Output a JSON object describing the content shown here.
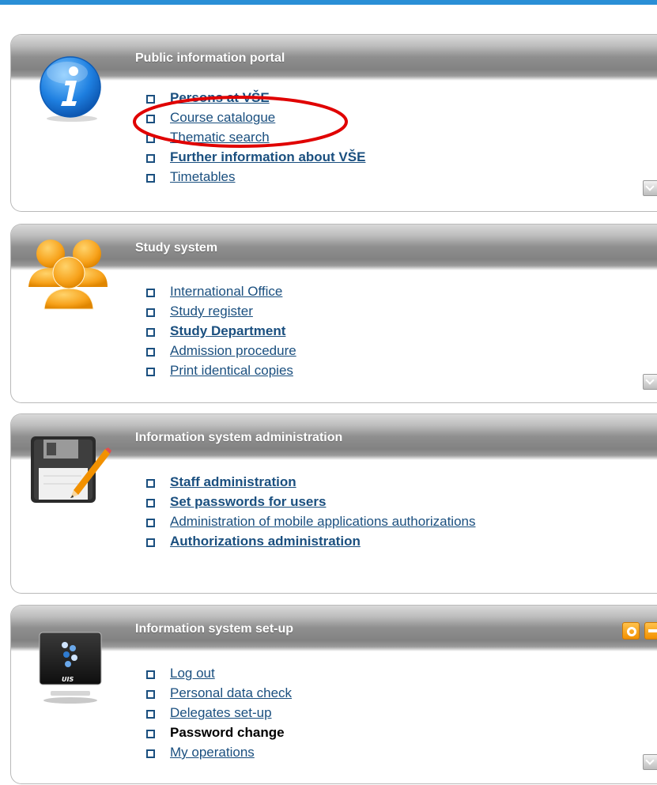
{
  "colors": {
    "top_bar": "#2a8fd6",
    "link": "#1a4f7f",
    "button_orange": "#f29100",
    "annotation_red": "#e00000"
  },
  "panels": [
    {
      "title": "Public information portal",
      "icon": "info-icon",
      "items": [
        {
          "label": "Persons at VŠE",
          "bold": true
        },
        {
          "label": "Course catalogue",
          "bold": false
        },
        {
          "label": "Thematic search",
          "bold": false
        },
        {
          "label": "Further information about VŠE",
          "bold": true
        },
        {
          "label": "Timetables",
          "bold": false
        }
      ]
    },
    {
      "title": "Study system",
      "icon": "people-icon",
      "items": [
        {
          "label": "International Office",
          "bold": false
        },
        {
          "label": "Study register",
          "bold": false
        },
        {
          "label": "Study Department",
          "bold": true
        },
        {
          "label": "Admission procedure",
          "bold": false
        },
        {
          "label": "Print identical copies",
          "bold": false
        }
      ]
    },
    {
      "title": "Information system administration",
      "icon": "floppy-pencil-icon",
      "items": [
        {
          "label": "Staff administration",
          "bold": true
        },
        {
          "label": "Set passwords for users",
          "bold": true
        },
        {
          "label": "Administration of mobile applications authorizations",
          "bold": false
        },
        {
          "label": "Authorizations administration",
          "bold": true
        }
      ]
    },
    {
      "title": "Information system set-up",
      "icon": "monitor-icon",
      "monitor_label": "UIS",
      "items": [
        {
          "label": "Log out",
          "bold": false
        },
        {
          "label": "Personal data check",
          "bold": false
        },
        {
          "label": "Delegates set-up",
          "bold": false
        },
        {
          "label": "Password change",
          "bold": true,
          "plain": true
        },
        {
          "label": "My operations",
          "bold": false
        }
      ]
    }
  ]
}
